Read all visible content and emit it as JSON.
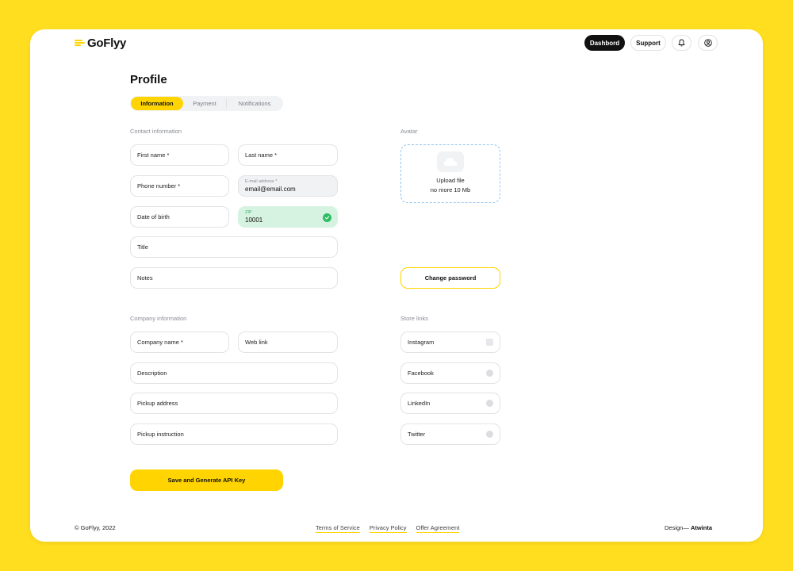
{
  "header": {
    "logo_text": "GoFlyy",
    "dashboard_label": "Dashbord",
    "support_label": "Support",
    "notifications_icon": "bell-icon",
    "account_icon": "user-circle-icon"
  },
  "page": {
    "title": "Profile",
    "tabs": [
      {
        "label": "Information",
        "active": true
      },
      {
        "label": "Payment",
        "active": false
      },
      {
        "label": "Notifications",
        "active": false
      }
    ]
  },
  "contact": {
    "section_label": "Contact information",
    "first_name": "First name *",
    "last_name": "Last name *",
    "phone": "Phone number *",
    "email_label": "E-mail address *",
    "email_value": "email@email.com",
    "dob": "Date of birth",
    "zip_label": "ZIP",
    "zip_value": "10001",
    "title": "Title",
    "notes": "Notes"
  },
  "avatar": {
    "section_label": "Avatar",
    "upload_line1": "Upload file",
    "upload_line2": "no more 10 Mb",
    "change_password": "Change password"
  },
  "company": {
    "section_label": "Company information",
    "company_name": "Company name *",
    "web_link": "Web link",
    "description": "Description",
    "pickup_address": "Pickup address",
    "pickup_instruction": "Pickup instruction"
  },
  "store_links": {
    "section_label": "Store links",
    "items": [
      {
        "label": "Instagram",
        "icon": "instagram-icon"
      },
      {
        "label": "Facebook",
        "icon": "facebook-icon"
      },
      {
        "label": "LinkedIn",
        "icon": "linkedin-icon"
      },
      {
        "label": "Twitter",
        "icon": "twitter-icon"
      }
    ]
  },
  "actions": {
    "save_label": "Save and Generate API Key"
  },
  "footer": {
    "copyright": "© GoFlyy, 2022",
    "links": [
      "Terms of Service",
      "Privacy Policy",
      "Offer Agreement"
    ],
    "design_prefix": "Design— ",
    "design_name": "Atwinta"
  },
  "colors": {
    "accent": "#FFD400",
    "background": "#FFDD1F",
    "success": "#2DBD62",
    "success_bg": "#D6F3E1",
    "dashed_border": "#93C6F1"
  }
}
